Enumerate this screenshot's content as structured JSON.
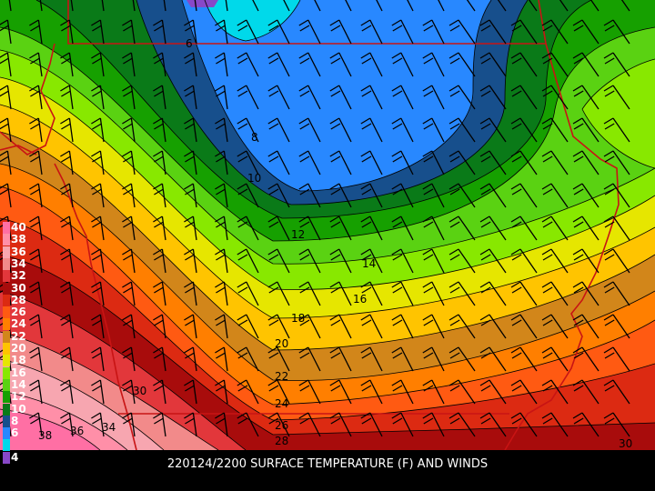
{
  "caption": "220124/2200 SURFACE TEMPERATURE (F) AND WINDS",
  "legend": [
    {
      "value": "40",
      "color": "#ff6fa4"
    },
    {
      "value": "38",
      "color": "#ff8fa8"
    },
    {
      "value": "36",
      "color": "#f7a6b0"
    },
    {
      "value": "34",
      "color": "#f28a8a"
    },
    {
      "value": "32",
      "color": "#e2373b"
    },
    {
      "value": "30",
      "color": "#a80c0c"
    },
    {
      "value": "28",
      "color": "#dc2a12"
    },
    {
      "value": "26",
      "color": "#ff5a12"
    },
    {
      "value": "24",
      "color": "#ff7f00"
    },
    {
      "value": "22",
      "color": "#d2861a"
    },
    {
      "value": "20",
      "color": "#ffc400"
    },
    {
      "value": "18",
      "color": "#e6e600"
    },
    {
      "value": "16",
      "color": "#88e800"
    },
    {
      "value": "14",
      "color": "#5ad212"
    },
    {
      "value": "12",
      "color": "#16a000"
    },
    {
      "value": "10",
      "color": "#0a7a18"
    },
    {
      "value": "8",
      "color": "#174f8c"
    },
    {
      "value": "6",
      "color": "#2888ff"
    },
    {
      "value": "",
      "color": "#00d9ea"
    },
    {
      "value": "4",
      "color": "#8848c8"
    }
  ],
  "contour_labels": [
    "6",
    "8",
    "10",
    "12",
    "14",
    "16",
    "18",
    "20",
    "22",
    "24",
    "26",
    "28",
    "30",
    "30",
    "34",
    "36",
    "38"
  ],
  "colors": {
    "band_40": "#ff6fa4",
    "band_38": "#ff8fa8",
    "band_36": "#f7a6b0",
    "band_34": "#f28a8a",
    "band_32": "#e2373b",
    "band_30": "#a80c0c",
    "band_28": "#dc2a12",
    "band_26": "#ff5a12",
    "band_24": "#ff7f00",
    "band_22": "#d2861a",
    "band_20": "#ffc400",
    "band_18": "#e6e600",
    "band_16": "#88e800",
    "band_14": "#5ad212",
    "band_12": "#16a000",
    "band_10": "#0a7a18",
    "band_8": "#174f8c",
    "band_6": "#2888ff",
    "band_4": "#00d9ea",
    "border": "#c81414"
  }
}
